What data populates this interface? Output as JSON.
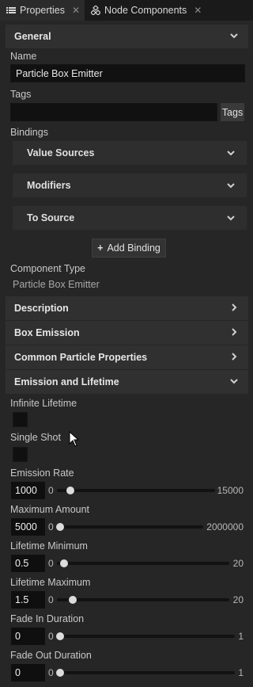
{
  "tabs": [
    {
      "label": "Properties",
      "close": "✕"
    },
    {
      "label": "Node Components",
      "close": "✕"
    }
  ],
  "general": {
    "title": "General"
  },
  "name": {
    "label": "Name",
    "value": "Particle Box Emitter"
  },
  "tags": {
    "label": "Tags",
    "value": "",
    "button": "Tags"
  },
  "bindings": {
    "label": "Bindings",
    "groups": [
      "Value Sources",
      "Modifiers",
      "To Source"
    ],
    "add_button": "Add Binding",
    "add_symbol": "+"
  },
  "component_type": {
    "label": "Component Type",
    "value": "Particle Box Emitter"
  },
  "sections": [
    "Description",
    "Box Emission",
    "Common Particle Properties",
    "Emission and Lifetime"
  ],
  "emission": {
    "infinite_lifetime": {
      "label": "Infinite Lifetime",
      "checked": false
    },
    "single_shot": {
      "label": "Single Shot",
      "checked": false
    },
    "sliders": [
      {
        "label": "Emission Rate",
        "value": "1000",
        "min": "0",
        "max": "15000",
        "fraction": 0.067
      },
      {
        "label": "Maximum Amount",
        "value": "5000",
        "min": "0",
        "max": "2000000",
        "fraction": 0.0025
      },
      {
        "label": "Lifetime Minimum",
        "value": "0.5",
        "min": "0",
        "max": "20",
        "fraction": 0.025
      },
      {
        "label": "Lifetime Maximum",
        "value": "1.5",
        "min": "0",
        "max": "20",
        "fraction": 0.075
      },
      {
        "label": "Fade In Duration",
        "value": "0",
        "min": "0",
        "max": "1",
        "fraction": 0
      },
      {
        "label": "Fade Out Duration",
        "value": "0",
        "min": "0",
        "max": "1",
        "fraction": 0
      }
    ]
  },
  "colors": {
    "accent_thumb": "#dcdcdc",
    "panel": "#262626",
    "header": "#303030",
    "field": "#111111"
  }
}
